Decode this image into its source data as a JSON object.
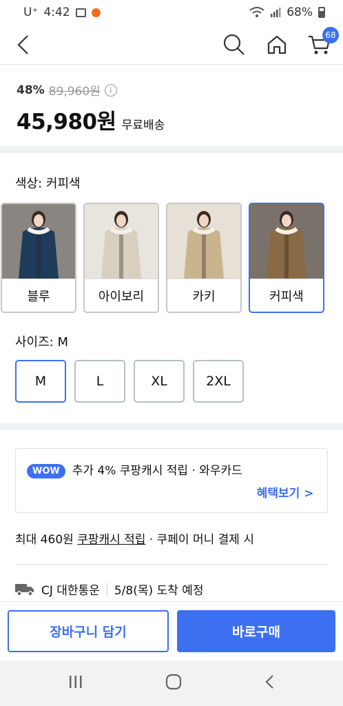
{
  "statusbar": {
    "carrier": "U⁺",
    "time": "4:42",
    "battery": "68%"
  },
  "header": {
    "cart_count": "68"
  },
  "price": {
    "discount_rate": "48%",
    "original_price": "89,960원",
    "final_price": "45,980원",
    "shipping": "무료배송"
  },
  "color_option": {
    "title": "색상: 커피색",
    "items": [
      {
        "label": "블루",
        "coat": "#1f3b5a",
        "bg": "#8a8580"
      },
      {
        "label": "아이보리",
        "coat": "#d8cfc0",
        "bg": "#e8e4de"
      },
      {
        "label": "카키",
        "coat": "#c9b48e",
        "bg": "#e6e0d6"
      },
      {
        "label": "커피색",
        "coat": "#8a6a44",
        "bg": "#7a716a"
      }
    ],
    "selected": "커피색"
  },
  "size_option": {
    "title": "사이즈: M",
    "items": [
      "M",
      "L",
      "XL",
      "2XL"
    ],
    "selected": "M"
  },
  "wow": {
    "badge": "WOW",
    "text": "추가 4% 쿠팡캐시 적립 · 와우카드",
    "link": "혜택보기 >"
  },
  "cash": {
    "prefix": "최대 460원 ",
    "underlined": "쿠팡캐시 적립",
    "suffix": " · 쿠페이 머니 결제 시"
  },
  "delivery": {
    "carrier": "CJ 대한통운",
    "eta": "5/8(목) 도착 예정"
  },
  "buttons": {
    "cart": "장바구니 담기",
    "buy": "바로구매"
  },
  "colors": {
    "accent": "#3d6ff1",
    "border": "#b9bec6",
    "separator": "#f0f1f3"
  }
}
